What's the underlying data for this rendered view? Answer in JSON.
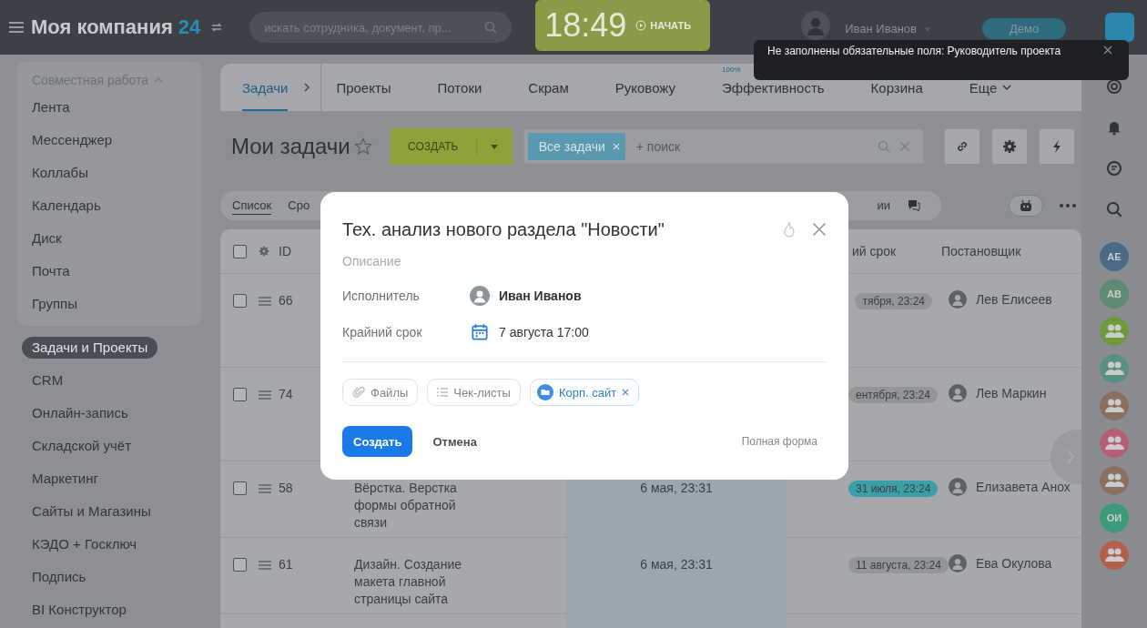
{
  "topbar": {
    "logo": "Моя компания",
    "logo_number": "24",
    "search": {
      "placeholder": "искать сотрудника, документ, пр..."
    },
    "clock": {
      "time": "18:49",
      "start": "НАЧАТЬ"
    },
    "user": "Иван Иванов",
    "plan": "Демо"
  },
  "toast": {
    "text": "Не заполнены обязательные поля: Руководитель проекта"
  },
  "sidebar": {
    "group": {
      "title": "Совместная работа",
      "expanded": true,
      "items": [
        {
          "label": "Лента",
          "selected": false
        },
        {
          "label": "Мессенджер",
          "selected": false
        },
        {
          "label": "Коллабы",
          "selected": false
        },
        {
          "label": "Календарь",
          "selected": false
        },
        {
          "label": "Диск",
          "selected": false
        },
        {
          "label": "Почта",
          "selected": false
        },
        {
          "label": "Группы",
          "selected": false
        }
      ]
    },
    "items": [
      {
        "label": "Задачи и Проекты",
        "selected": true
      },
      {
        "label": "CRM",
        "selected": false
      },
      {
        "label": "Онлайн-запись",
        "selected": false
      },
      {
        "label": "Складской учёт",
        "selected": false
      },
      {
        "label": "Маркетинг",
        "selected": false
      },
      {
        "label": "Сайты и Магазины",
        "selected": false
      },
      {
        "label": "КЭДО + Госключ",
        "selected": false
      },
      {
        "label": "Подпись",
        "selected": false
      },
      {
        "label": "BI Конструктор",
        "selected": false
      }
    ]
  },
  "tabs": [
    {
      "label": "Задачи",
      "selected": true,
      "chevron": true
    },
    {
      "label": "Проекты",
      "selected": false
    },
    {
      "label": "Потоки",
      "selected": false
    },
    {
      "label": "Скрам",
      "selected": false
    },
    {
      "label": "Руковожу",
      "selected": false
    },
    {
      "label": "Эффективность",
      "selected": false,
      "badge": "100%"
    },
    {
      "label": "Корзина",
      "selected": false
    },
    {
      "label": "Еще",
      "selected": false,
      "dropdown": true
    }
  ],
  "page_title": "Мои задачи",
  "create_button": "СОЗДАТЬ",
  "filter": {
    "tag": "Все задачи",
    "placeholder": "+ поиск"
  },
  "view_tabs": [
    {
      "label": "Список",
      "selected": true
    },
    {
      "label": "Сро",
      "selected": false
    },
    {
      "label": "ии",
      "selected": false
    }
  ],
  "table": {
    "header_checked": false,
    "columns": {
      "id": "ID",
      "deadline": "ий срок",
      "creator": "Постановщик"
    },
    "rows": [
      {
        "id": "66",
        "checked": false,
        "deadline": {
          "label": "тября, 23:24",
          "color": "#939597"
        },
        "creator": "Лев Елисеев"
      },
      {
        "id": "74",
        "checked": false,
        "deadline": {
          "label": "ентября, 23:24",
          "color": "#939597"
        },
        "creator": "Лев Маркин"
      },
      {
        "id": "58",
        "checked": false,
        "name": "Вёрстка. Верстка формы обратной связи",
        "activity": "6 мая, 23:31",
        "deadline": {
          "label": "31 июля, 23:24",
          "color": "#3a9fa6"
        },
        "creator": "Елизавета Анох"
      },
      {
        "id": "61",
        "checked": false,
        "name": "Дизайн. Создание макета главной страницы сайта",
        "activity": "6 мая, 23:31",
        "deadline": {
          "label": "11 августа, 23:24",
          "color": "#939597"
        },
        "creator": "Ева Окулова"
      }
    ]
  },
  "right_bar": {
    "avatars": [
      {
        "kind": "initials",
        "initials": "АЕ",
        "color": "#4a6a86"
      },
      {
        "kind": "initials",
        "initials": "АВ",
        "color": "#5f8a74"
      },
      {
        "kind": "group",
        "color": "#6e9a3c"
      },
      {
        "kind": "group",
        "color": "#5a9080"
      },
      {
        "kind": "group",
        "color": "#8a6e60"
      },
      {
        "kind": "group",
        "color": "#b65e74"
      },
      {
        "kind": "group",
        "color": "#8a6e60"
      },
      {
        "kind": "initials",
        "initials": "ОИ",
        "color": "#3d9a78"
      },
      {
        "kind": "group",
        "color": "#b2604a"
      }
    ]
  },
  "modal": {
    "title": "Тех. анализ нового раздела \"Новости\"",
    "description_placeholder": "Описание",
    "fields": [
      {
        "kind": "person",
        "label": "Исполнитель",
        "value": "Иван Иванов"
      },
      {
        "kind": "date",
        "label": "Крайний срок",
        "value": "7 августа 17:00"
      }
    ],
    "chips": [
      {
        "kind": "files",
        "label": "Файлы"
      },
      {
        "kind": "checklist",
        "label": "Чек-листы"
      },
      {
        "kind": "project",
        "label": "Корп. сайт"
      }
    ],
    "primary_button": "Создать",
    "cancel_button": "Отмена",
    "full_form_link": "Полная форма"
  }
}
